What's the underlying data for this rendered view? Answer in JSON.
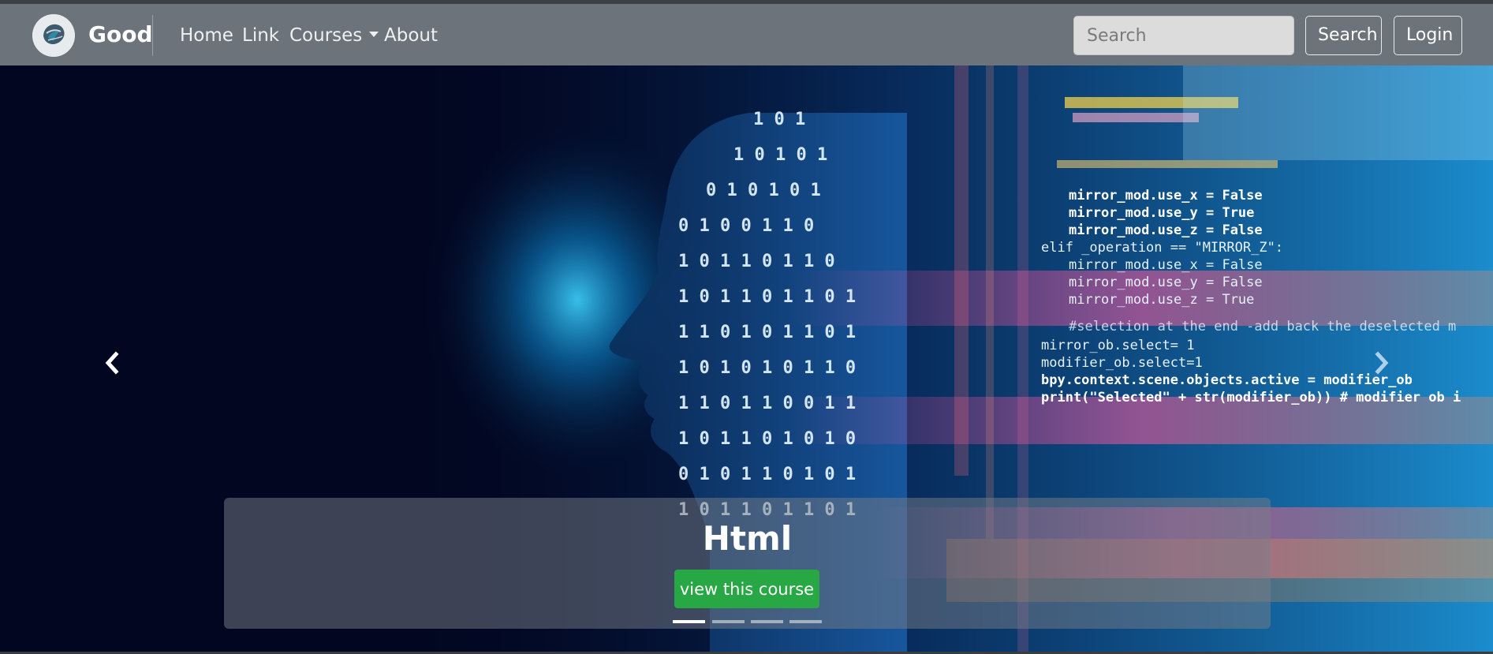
{
  "navbar": {
    "brand": "Good",
    "links": [
      {
        "label": "Home"
      },
      {
        "label": "Link"
      },
      {
        "label": "Courses"
      },
      {
        "label": "About"
      }
    ],
    "search": {
      "placeholder": "Search",
      "button_label": "Search"
    },
    "login_label": "Login"
  },
  "carousel": {
    "caption_title": "Html",
    "caption_button": "view this course",
    "prev_icon": "chevron-left-icon",
    "next_icon": "chevron-right-icon",
    "slide_count": 4,
    "active_slide": 1
  },
  "colors": {
    "navbar": "#6c737a",
    "button_success": "#28a745"
  }
}
